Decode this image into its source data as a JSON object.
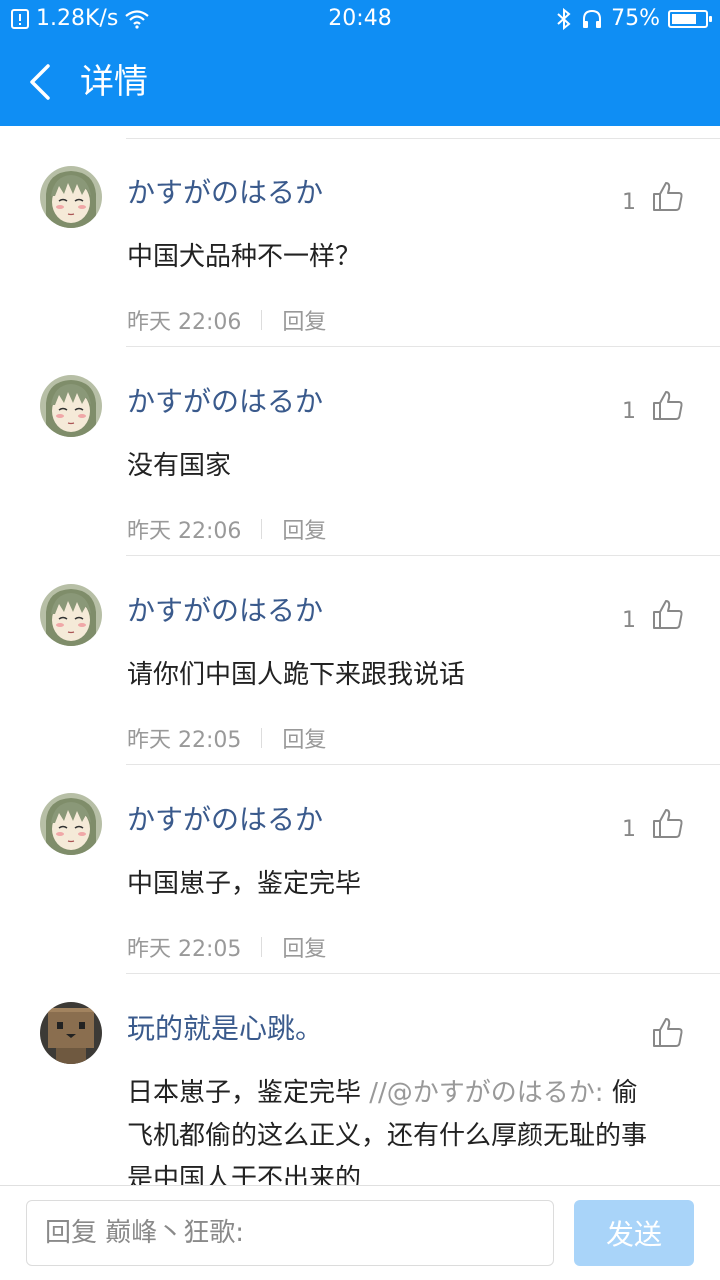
{
  "status_bar": {
    "net_speed": "1.28K/s",
    "time": "20:48",
    "battery": "75%",
    "battery_level": 0.75
  },
  "header": {
    "title": "详情"
  },
  "comments": [
    {
      "username": "かすがのはるか",
      "likes": "1",
      "text": "中国犬品种不一样？",
      "time": "昨天 22:06",
      "reply": "回复",
      "avatar": "anime-avatar"
    },
    {
      "username": "かすがのはるか",
      "likes": "1",
      "text": "没有国家",
      "time": "昨天 22:06",
      "reply": "回复",
      "avatar": "anime-avatar"
    },
    {
      "username": "かすがのはるか",
      "likes": "1",
      "text": "请你们中国人跪下来跟我说话",
      "time": "昨天 22:05",
      "reply": "回复",
      "avatar": "anime-avatar"
    },
    {
      "username": "かすがのはるか",
      "likes": "1",
      "text": "中国崽子，鉴定完毕",
      "time": "昨天 22:05",
      "reply": "回复",
      "avatar": "anime-avatar"
    },
    {
      "username": "玩的就是心跳。",
      "likes": "",
      "text": "日本崽子，鉴定完毕 ",
      "quoted_prefix": "//@かすがのはるか:",
      "quoted_text": " 偷飞机都偷的这么正义，还有什么厚颜无耻的事是中国人干不出来的",
      "avatar": "danbo-avatar"
    }
  ],
  "reply_bar": {
    "placeholder": "回复 巅峰丶狂歌:",
    "send_label": "发送"
  },
  "colors": {
    "accent": "#0f8ef4",
    "username": "#3a5a8c",
    "send_disabled": "#a9d4f9"
  }
}
